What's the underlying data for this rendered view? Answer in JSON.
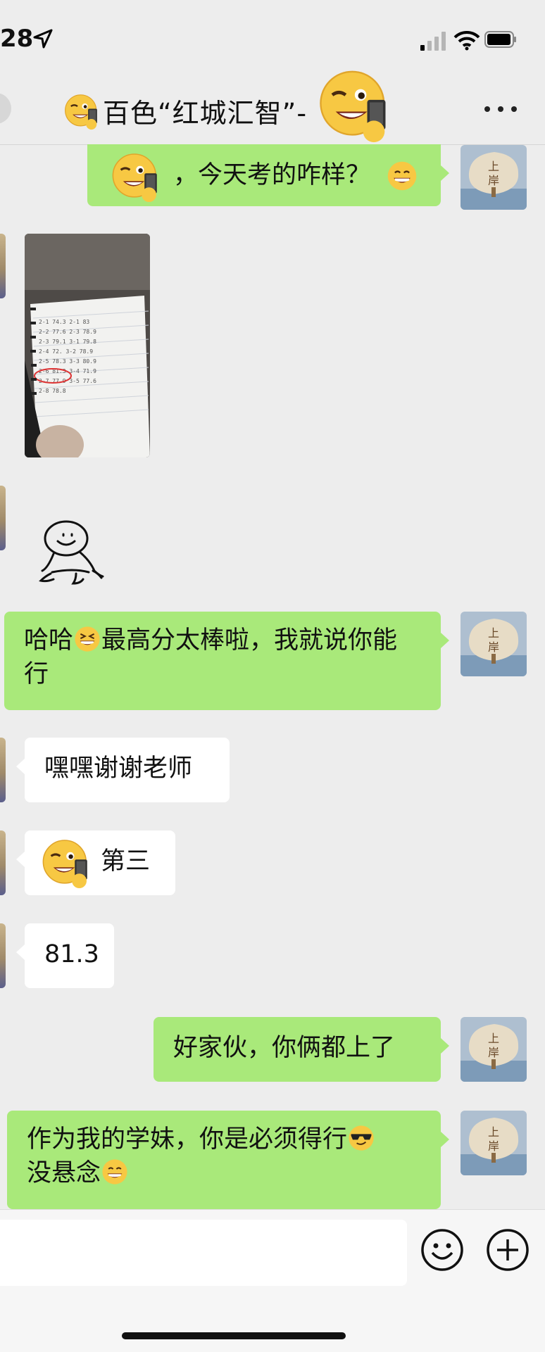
{
  "status_bar": {
    "time": "28",
    "icons": [
      "location-arrow-icon",
      "signal-icon",
      "wifi-icon",
      "battery-icon"
    ]
  },
  "header": {
    "title": "百色“红城汇智”-",
    "icons": [
      "back-icon",
      "smirk-phone-emoji",
      "more-icon"
    ]
  },
  "messages": [
    {
      "side": "sent",
      "text": "，今天考的咋样？",
      "emoji_before": "smirk-phone-emoji",
      "emoji_after": "grin-emoji"
    },
    {
      "side": "received",
      "type": "image",
      "content": "handwritten-score-notes"
    },
    {
      "side": "received",
      "type": "sticker",
      "content": "stick-figure-sticker"
    },
    {
      "side": "sent",
      "parts": [
        "哈哈",
        "最高分太棒啦，我就说你能行"
      ],
      "emoji": "laughing-emoji"
    },
    {
      "side": "received",
      "text": "嘿嘿谢谢老师"
    },
    {
      "side": "received",
      "text": "第三",
      "emoji_before": "smirk-phone-emoji"
    },
    {
      "side": "received",
      "text": "81.3"
    },
    {
      "side": "sent",
      "text": "好家伙，你俩都上了"
    },
    {
      "side": "sent",
      "parts": [
        "作为我的学妹，你是必须得行",
        "没悬念"
      ],
      "emojis": [
        "cool-emoji",
        "grin-emoji"
      ]
    }
  ],
  "avatar_self": {
    "label": "上岸"
  },
  "colors": {
    "sent_bubble": "#a9e97a",
    "received_bubble": "#ffffff",
    "background": "#ededed"
  },
  "input_bar": {
    "placeholder": "",
    "icons": [
      "smile-icon",
      "plus-icon"
    ]
  }
}
